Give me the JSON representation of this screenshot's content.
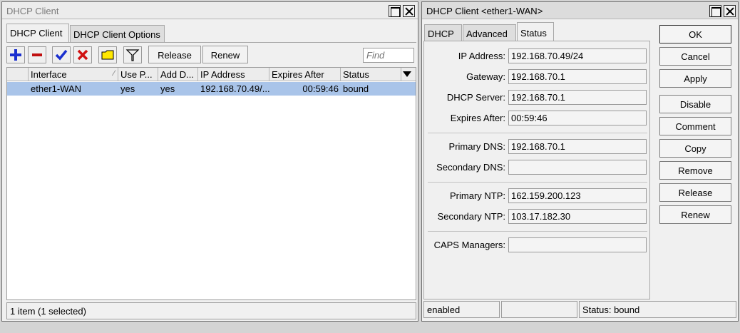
{
  "left_window": {
    "title": "DHCP Client",
    "tabs": [
      "DHCP Client",
      "DHCP Client Options"
    ],
    "toolbar": {
      "add_icon": "plus-icon",
      "remove_icon": "minus-icon",
      "enable_icon": "check-icon",
      "disable_icon": "x-icon",
      "comment_icon": "note-icon",
      "filter_icon": "filter-icon",
      "release_label": "Release",
      "renew_label": "Renew",
      "find_placeholder": "Find"
    },
    "columns": [
      "Interface",
      "Use P...",
      "Add D...",
      "IP Address",
      "Expires After",
      "Status"
    ],
    "rows": [
      {
        "interface": "ether1-WAN",
        "use_peer": "yes",
        "add_default": "yes",
        "ip_address": "192.168.70.49/...",
        "expires_after": "00:59:46",
        "status": "bound"
      }
    ],
    "status_text": "1 item (1 selected)"
  },
  "right_window": {
    "title": "DHCP Client <ether1-WAN>",
    "tabs": [
      "DHCP",
      "Advanced",
      "Status"
    ],
    "fields": [
      {
        "label": "IP Address:",
        "value": "192.168.70.49/24"
      },
      {
        "label": "Gateway:",
        "value": "192.168.70.1"
      },
      {
        "label": "DHCP Server:",
        "value": "192.168.70.1"
      },
      {
        "label": "Expires After:",
        "value": "00:59:46"
      },
      {
        "label": "Primary DNS:",
        "value": "192.168.70.1"
      },
      {
        "label": "Secondary DNS:",
        "value": ""
      },
      {
        "label": "Primary NTP:",
        "value": "162.159.200.123"
      },
      {
        "label": "Secondary NTP:",
        "value": "103.17.182.30"
      },
      {
        "label": "CAPS Managers:",
        "value": ""
      }
    ],
    "buttons": [
      "OK",
      "Cancel",
      "Apply",
      "Disable",
      "Comment",
      "Copy",
      "Remove",
      "Release",
      "Renew"
    ],
    "status": {
      "state": "enabled",
      "middle": "",
      "right": "Status: bound"
    }
  },
  "colors": {
    "selection": "#a9c4e9",
    "add_icon": "#1a2fcf",
    "remove_icon": "#c01010",
    "note_icon": "#ffe800"
  }
}
